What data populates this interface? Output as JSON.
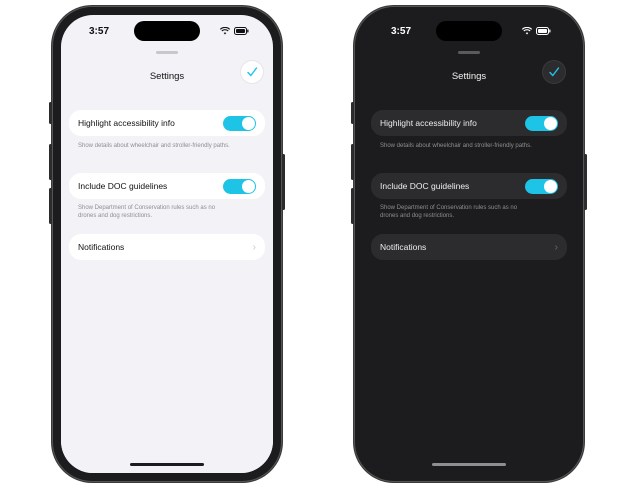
{
  "status": {
    "time": "3:57"
  },
  "settings": {
    "title": "Settings",
    "rows": [
      {
        "label": "Highlight accessibility info",
        "note": "Show details about wheelchair and stroller-friendly paths.",
        "toggle_on": true
      },
      {
        "label": "Include DOC guidelines",
        "note": "Show Department of Conservation rules such as no drones and dog restrictions.",
        "toggle_on": true
      }
    ],
    "notifications_label": "Notifications"
  },
  "colors": {
    "accent": "#1EC4E6",
    "light_bg": "#F2F2F7",
    "dark_bg": "#1C1C1E"
  },
  "icons": {
    "done": "checkmark-icon",
    "chevron": "chevron-right-icon"
  }
}
